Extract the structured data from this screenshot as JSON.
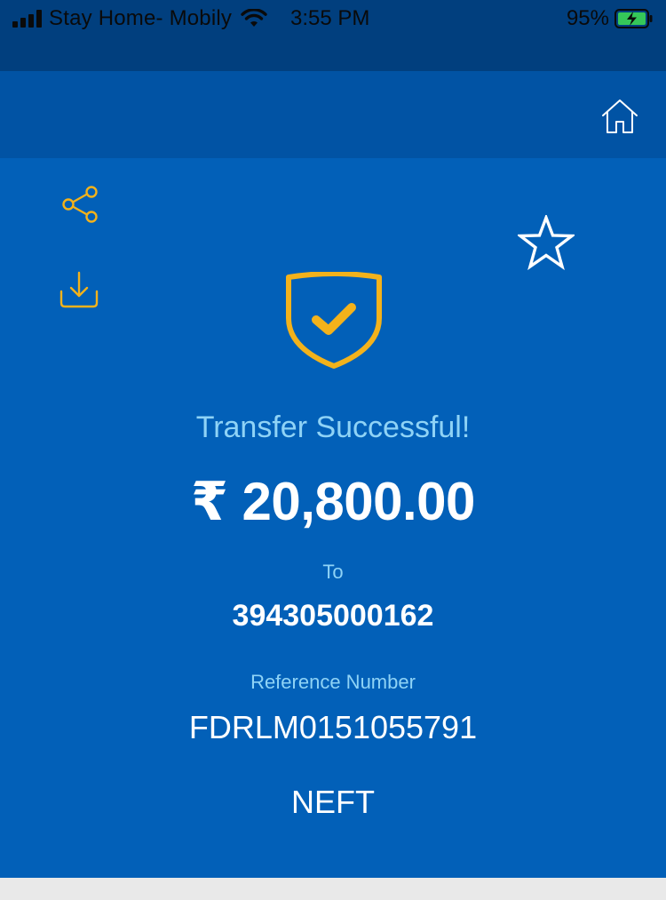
{
  "status_bar": {
    "carrier": "Stay Home- Mobily",
    "time": "3:55 PM",
    "battery_percent": "95%",
    "signal_icon": "signal-bars-icon",
    "wifi_icon": "wifi-icon",
    "battery_icon": "battery-charging-icon"
  },
  "header": {
    "home_icon": "home-icon"
  },
  "actions": {
    "share_icon": "share-icon",
    "download_icon": "download-icon",
    "favorite_icon": "star-icon"
  },
  "result": {
    "status_icon": "shield-check-icon",
    "message": "Transfer Successful!",
    "amount": "₹ 20,800.00",
    "to_label": "To",
    "to_account": "394305000162",
    "reference_label": "Reference Number",
    "reference_number": "FDRLM0151055791",
    "transfer_mode": "NEFT"
  },
  "colors": {
    "status_bar_bg": "#013f7e",
    "header_bg": "#0153a4",
    "card_bg": "#0260b8",
    "accent_yellow": "#f3b21b",
    "label_light_blue": "#8fd3f6",
    "text_white": "#ffffff",
    "footer_bg": "#e9e9e9"
  }
}
